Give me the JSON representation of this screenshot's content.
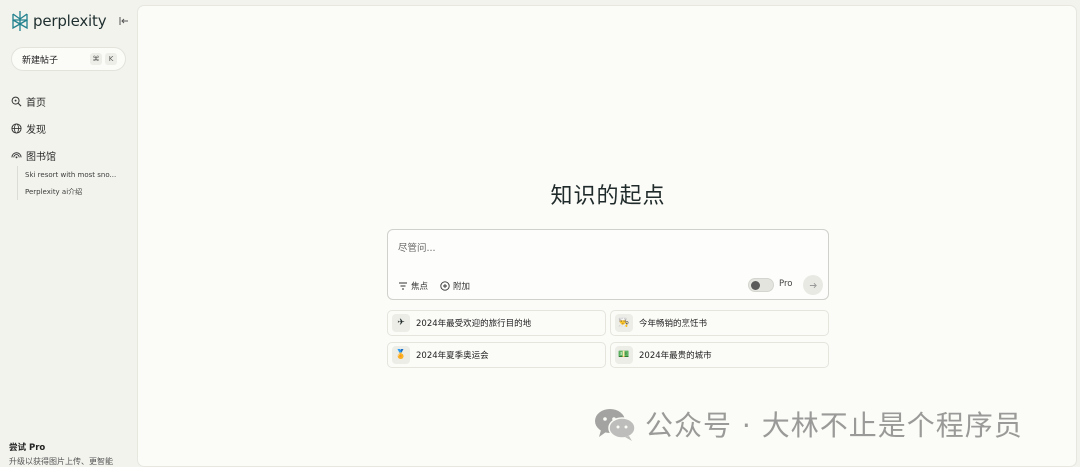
{
  "sidebar": {
    "brand": "perplexity",
    "new_thread_label": "新建帖子",
    "shortcut": [
      "⌘",
      "K"
    ],
    "nav": [
      {
        "label": "首页",
        "icon": "search-icon"
      },
      {
        "label": "发现",
        "icon": "globe-icon"
      },
      {
        "label": "图书馆",
        "icon": "library-icon"
      }
    ],
    "library_items": [
      "Ski resort with most sno...",
      "Perplexity ai介绍"
    ],
    "try_pro": {
      "title": "尝试 Pro",
      "desc": "升级以获得图片上传、更智能"
    }
  },
  "main": {
    "title": "知识的起点",
    "ask": {
      "placeholder": "尽管问...",
      "focus_label": "焦点",
      "attach_label": "附加",
      "pro_label": "Pro",
      "pro_enabled": false
    },
    "suggestions": [
      {
        "icon": "✈",
        "label": "2024年最受欢迎的旅行目的地"
      },
      {
        "icon": "👨‍🍳",
        "label": "今年畅销的烹饪书"
      },
      {
        "icon": "🏅",
        "label": "2024年夏季奥运会"
      },
      {
        "icon": "💵",
        "label": "2024年最贵的城市"
      }
    ]
  },
  "watermark": {
    "text": "公众号 · 大林不止是个程序员"
  },
  "colors": {
    "background": "#f3f3ee",
    "panel": "#fbfbf7",
    "accent": "#20808d"
  }
}
